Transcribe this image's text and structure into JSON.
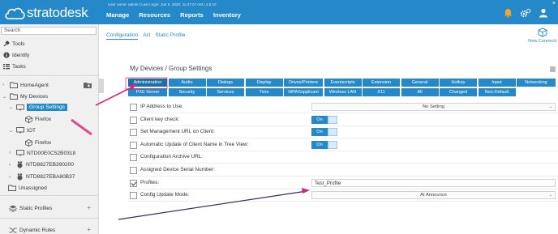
{
  "app": {
    "logo_text": "stratodesk",
    "user_info": "User name: admin | Last Login: Jun 5, 2020, 11:37:07 AM |  4.5.10"
  },
  "nav": [
    "Manage",
    "Resources",
    "Reports",
    "Inventory"
  ],
  "sidebar": {
    "search_placeholder": "Search",
    "tools": [
      "Tools",
      "Identify",
      "Tasks"
    ],
    "tree": {
      "home_agent": "HomeAgent",
      "my_devices": "My Devices",
      "group_settings": "Group Settings",
      "firefox1": "Firefox",
      "iot": "IOT",
      "firefox2": "Firefox",
      "device1": "NTD00E0C52B0318",
      "device2": "NTD8827EB390200",
      "device3": "NTD8827EBA80B37",
      "unassigned": "Unassigned"
    },
    "static_profiles": "Static Profiles",
    "dynamic_rules": "Dynamic Rules"
  },
  "subtabs": [
    "Configuration",
    "Acl",
    "Static Profile"
  ],
  "new_connection": "New Connecti",
  "page_title": "My Devices / Group Settings",
  "tabs_row1": [
    "Administration",
    "Audio",
    "Dialogs",
    "Display",
    "Drives/Printers",
    "Eventscripts",
    "Extension",
    "General",
    "Hotkey",
    "Input",
    "Networking"
  ],
  "tabs_row2": [
    "PXE Server",
    "Security",
    "Services",
    "Time",
    "WPASupplicant",
    "Wireless LAN",
    "X11",
    "All",
    "Changed",
    "Non-Default"
  ],
  "settings": [
    {
      "label": "IP Address to Use:",
      "checked": false,
      "kind": "select",
      "value": "No Setting"
    },
    {
      "label": "Client key check:",
      "checked": false,
      "kind": "toggle",
      "value": "On"
    },
    {
      "label": "Set Management URL on Client:",
      "checked": false,
      "kind": "toggle",
      "value": "On"
    },
    {
      "label": "Automatic Update of Client Name in Tree View:",
      "checked": false,
      "kind": "toggle",
      "value": "On"
    },
    {
      "label": "Configuration Archive URL:",
      "checked": false,
      "kind": "none",
      "value": ""
    },
    {
      "label": "Assigned Device Serial Number:",
      "checked": false,
      "kind": "none",
      "value": ""
    },
    {
      "label": "Profiles:",
      "checked": true,
      "kind": "text",
      "value": "Test_Profile"
    },
    {
      "label": "Config Update Mode:",
      "checked": false,
      "kind": "select",
      "value": "At Announce"
    }
  ],
  "colors": {
    "primary": "#2589c9",
    "annotation": "#e0207a"
  }
}
